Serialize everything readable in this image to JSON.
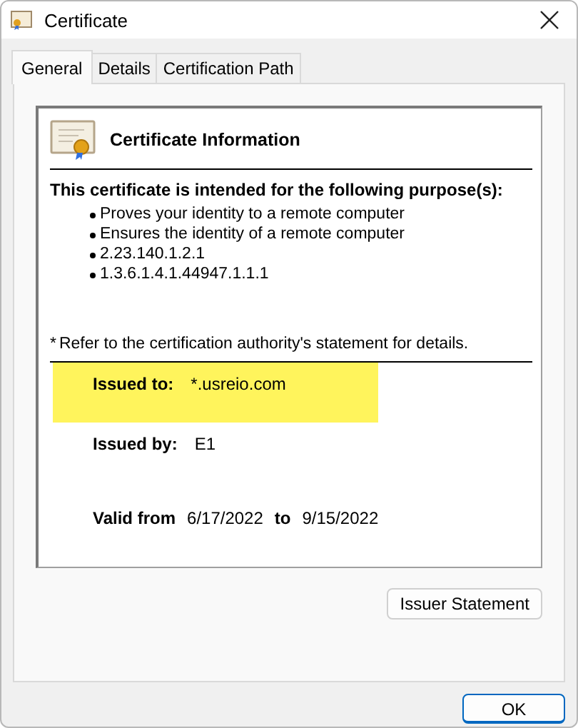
{
  "window": {
    "title": "Certificate"
  },
  "tabs": [
    {
      "label": "General",
      "selected": true
    },
    {
      "label": "Details",
      "selected": false
    },
    {
      "label": "Certification Path",
      "selected": false
    }
  ],
  "info": {
    "heading": "Certificate Information",
    "purpose_heading": "This certificate is intended for the following purpose(s):",
    "purposes": [
      "Proves your identity to a remote computer",
      "Ensures the identity of a remote computer",
      "2.23.140.1.2.1",
      "1.3.6.1.4.1.44947.1.1.1"
    ],
    "footnote_mark": "*",
    "footnote": "Refer to the certification authority's statement for details."
  },
  "fields": [
    {
      "label": "Issued to:",
      "value": "*.usreio.com",
      "highlighted": true
    },
    {
      "label": "Issued by:",
      "value": "E1",
      "highlighted": false
    }
  ],
  "validity": {
    "label": "Valid from",
    "from": "6/17/2022",
    "to_label": "to",
    "to": "9/15/2022"
  },
  "buttons": {
    "issuer_statement": "Issuer Statement",
    "ok": "OK"
  }
}
